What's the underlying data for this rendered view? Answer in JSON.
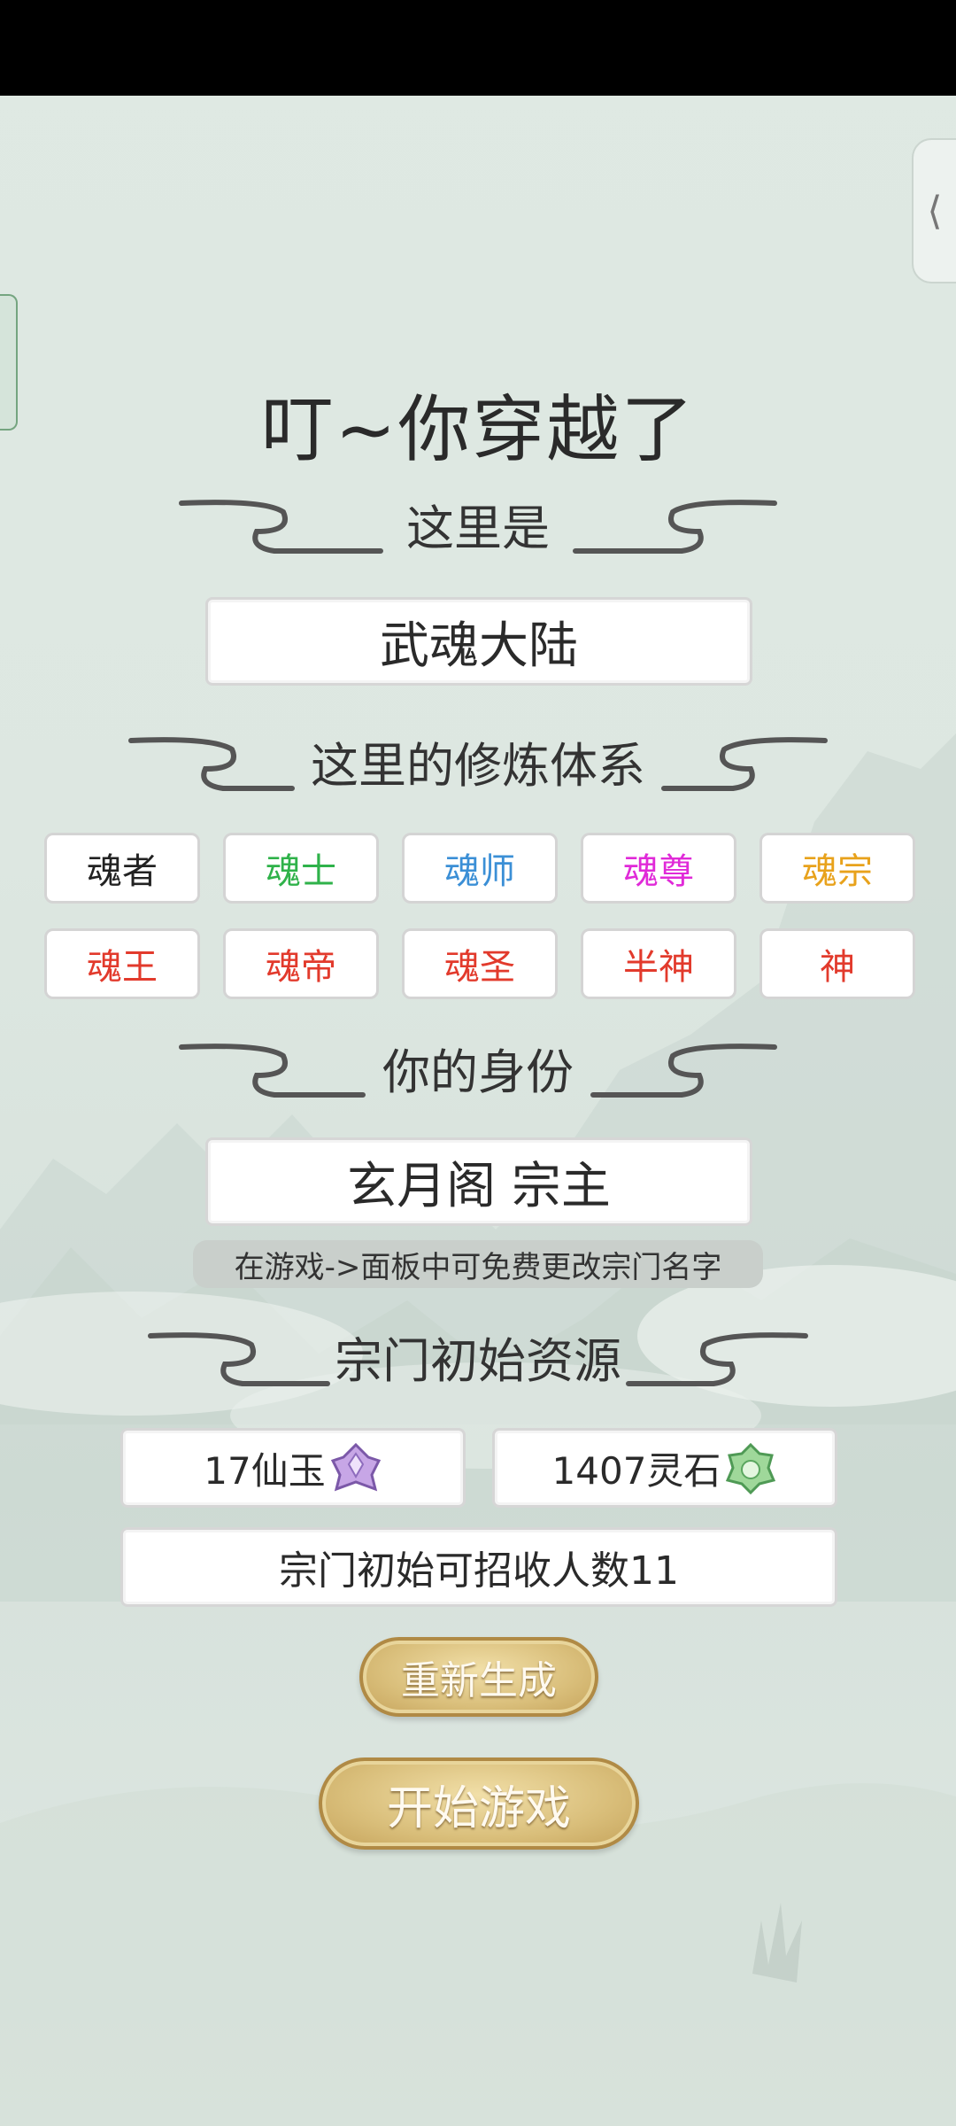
{
  "title": "叮~你穿越了",
  "sections": {
    "world": {
      "heading": "这里是",
      "value": "武魂大陆"
    },
    "cultivation": {
      "heading": "这里的修炼体系"
    },
    "identity": {
      "heading": "你的身份",
      "value": "玄月阁 宗主",
      "hint": "在游戏->面板中可免费更改宗门名字"
    },
    "resources": {
      "heading": "宗门初始资源"
    }
  },
  "realms": [
    {
      "label": "魂者",
      "color": "#222222"
    },
    {
      "label": "魂士",
      "color": "#2fb24a"
    },
    {
      "label": "魂师",
      "color": "#3b8fd6"
    },
    {
      "label": "魂尊",
      "color": "#e02ad8"
    },
    {
      "label": "魂宗",
      "color": "#e8a21c"
    },
    {
      "label": "魂王",
      "color": "#e23a2c"
    },
    {
      "label": "魂帝",
      "color": "#e23a2c"
    },
    {
      "label": "魂圣",
      "color": "#e23a2c"
    },
    {
      "label": "半神",
      "color": "#e23a2c"
    },
    {
      "label": "神",
      "color": "#e23a2c"
    }
  ],
  "resources": {
    "jade": {
      "text": "17仙玉",
      "icon": "purple-jade-icon"
    },
    "spirit_stone": {
      "text": "1407灵石",
      "icon": "green-spirit-stone-icon"
    },
    "recruit": "宗门初始可招收人数11"
  },
  "buttons": {
    "regenerate": "重新生成",
    "start": "开始游戏"
  },
  "side_tab_right": {
    "icon": "chevron-left-icon",
    "glyph": "⟨"
  },
  "colors": {
    "background": "#dde7e1",
    "gold": "#d9be7a",
    "box_border": "#d6d6d6"
  }
}
